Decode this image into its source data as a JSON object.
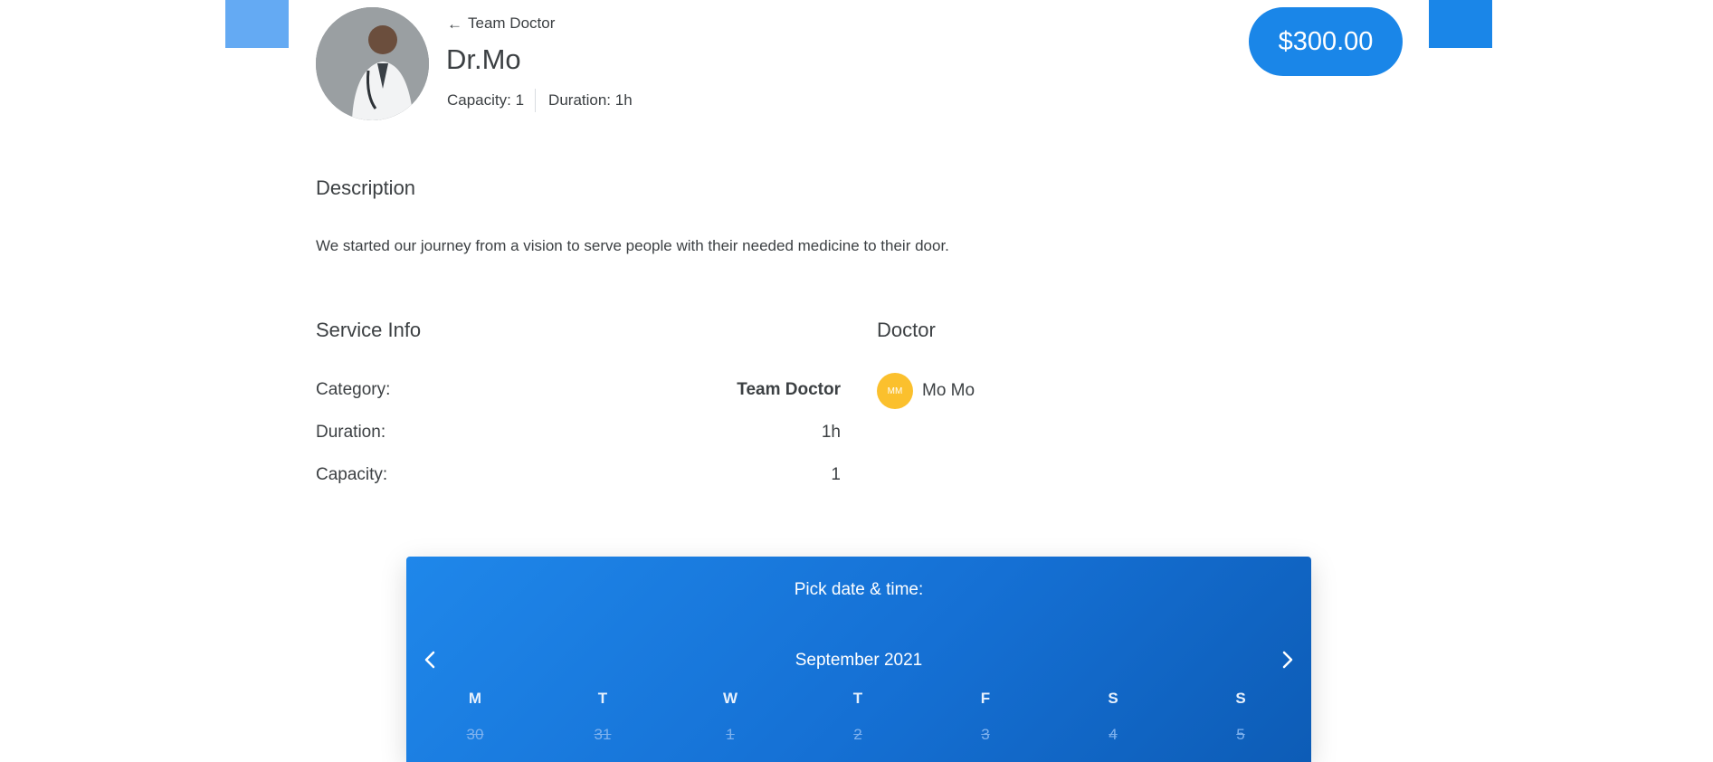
{
  "header": {
    "back_label": "Team Doctor",
    "title": "Dr.Mo",
    "capacity": "Capacity: 1",
    "duration": "Duration: 1h",
    "price": "$300.00"
  },
  "description": {
    "heading": "Description",
    "text": "We started our journey from a vision to serve people with their needed medicine to their door."
  },
  "service_info": {
    "heading": "Service Info",
    "rows": [
      {
        "label": "Category:",
        "value": "Team Doctor"
      },
      {
        "label": "Duration:",
        "value": "1h"
      },
      {
        "label": "Capacity:",
        "value": "1"
      }
    ]
  },
  "doctor": {
    "heading": "Doctor",
    "initials": "MM",
    "name": "Mo Mo",
    "badge_color": "#fbc02d"
  },
  "calendar": {
    "heading": "Pick date & time:",
    "month": "September 2021",
    "weekdays": [
      "M",
      "T",
      "W",
      "T",
      "F",
      "S",
      "S"
    ],
    "days": [
      "30",
      "31",
      "1",
      "2",
      "3",
      "4",
      "5"
    ]
  },
  "colors": {
    "accent": "#1a86e8",
    "accent_light": "#64aaf3"
  }
}
